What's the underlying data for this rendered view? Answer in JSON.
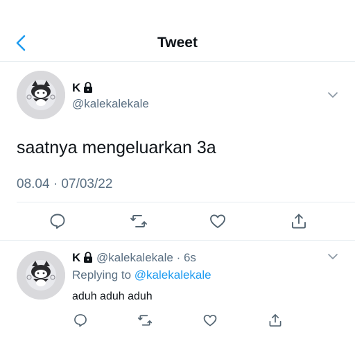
{
  "header": {
    "title": "Tweet"
  },
  "main_tweet": {
    "display_name": "K",
    "handle": "@kalekalekale",
    "text": "saatnya mengeluarkan 3a",
    "meta": "08.04 · 07/03/22"
  },
  "reply": {
    "display_name": "K",
    "handle": "@kalekalekale",
    "time": "· 6s",
    "replying_prefix": "Replying to",
    "replying_to": "@kalekalekale",
    "text": "aduh aduh aduh"
  },
  "colors": {
    "accent": "#1d9bf0",
    "secondary_text": "#5b7083",
    "divider": "#e6ecf0"
  }
}
